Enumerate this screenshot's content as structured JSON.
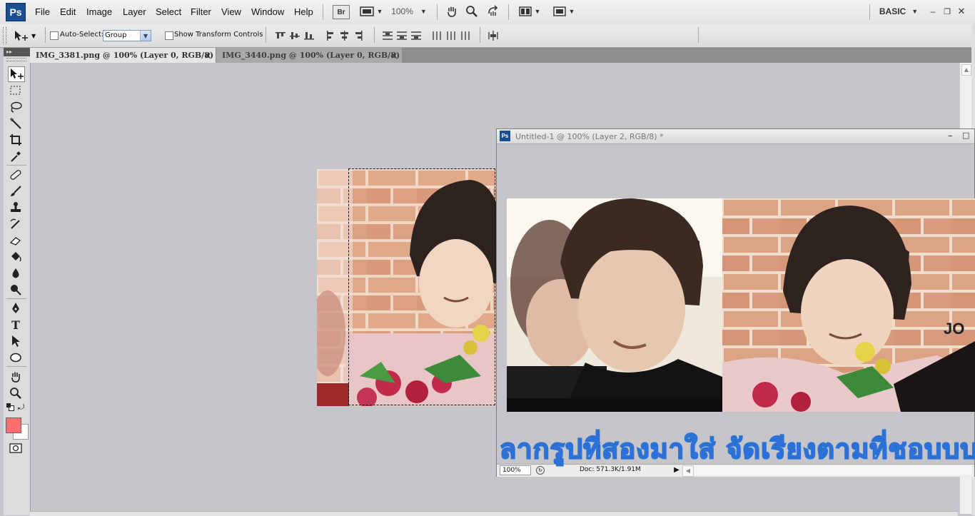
{
  "app": {
    "logo": "Ps",
    "workspace": "BASIC",
    "zoom": "100%"
  },
  "menu": [
    "File",
    "Edit",
    "Image",
    "Layer",
    "Select",
    "Filter",
    "View",
    "Window",
    "Help"
  ],
  "appbar": {
    "bridge": "Br"
  },
  "options": {
    "auto_select_label": "Auto-Select:",
    "auto_select_value": "Group",
    "transform_label": "Show Transform Controls"
  },
  "tabs": [
    {
      "label": "IMG_3381.png @ 100% (Layer 0, RGB/8)",
      "close": "×",
      "active": true
    },
    {
      "label": "IMG_3440.png @ 100% (Layer 0, RGB/8)",
      "close": "×",
      "active": false
    }
  ],
  "floating_window": {
    "logo": "Ps",
    "title": "Untitled-1 @ 100% (Layer 2, RGB/8) *",
    "zoom": "100%",
    "doc_info": "Doc: 571.3K/1.91M",
    "overlay_text": "ลากรูปที่สองมาใส่  จัดเรียงตามที่ชอบบบ",
    "photo_watermark": "JO"
  },
  "colors": {
    "foreground": "#ff6f6f",
    "background": "#ffffff",
    "canvas": "#c6c5c9"
  },
  "icons": [
    "move-icon",
    "marquee-icon",
    "lasso-icon",
    "magic-wand-icon",
    "crop-icon",
    "eyedropper-icon",
    "healing-brush-icon",
    "brush-icon",
    "clone-stamp-icon",
    "history-brush-icon",
    "eraser-icon",
    "paint-bucket-icon",
    "blur-icon",
    "dodge-icon",
    "pen-icon",
    "type-icon",
    "path-select-icon",
    "ellipse-icon",
    "hand-icon",
    "zoom-icon"
  ],
  "tools": {
    "type_glyph": "T"
  }
}
